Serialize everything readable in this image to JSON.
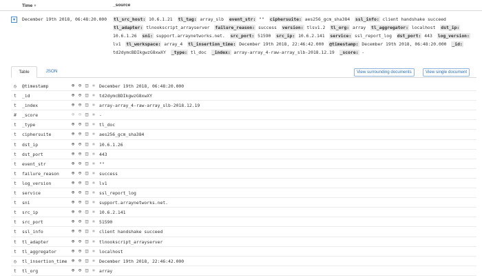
{
  "header": {
    "time_label": "Time",
    "time_sort_icon": "▾",
    "source_label": "_source"
  },
  "row": {
    "time": "December 19th 2018, 06:48:20.000",
    "toggle_icon": "▾",
    "source_pairs": [
      {
        "k": "tl_src_host:",
        "v": "10.6.1.21"
      },
      {
        "k": "tl_tag:",
        "v": "array_slb"
      },
      {
        "k": "event_str:",
        "v": "\"\""
      },
      {
        "k": "ciphersuite:",
        "v": "aes256_gcm_sha384"
      },
      {
        "k": "ssl_info:",
        "v": "client handshake succeed"
      },
      {
        "k": "tl_adapter:",
        "v": "tlnookscript_arrayserver"
      },
      {
        "k": "failure_reason:",
        "v": "success"
      },
      {
        "k": "version:",
        "v": "tlsv1.2"
      },
      {
        "k": "tl_org:",
        "v": "array"
      },
      {
        "k": "tl_aggregator:",
        "v": "localhost"
      },
      {
        "k": "dst_ip:",
        "v": "10.6.1.26"
      },
      {
        "k": "sni:",
        "v": "support.arraynetworks.net."
      },
      {
        "k": "src_port:",
        "v": "51590"
      },
      {
        "k": "src_ip:",
        "v": "10.6.2.141"
      },
      {
        "k": "service:",
        "v": "ssl_report_log"
      },
      {
        "k": "dst_port:",
        "v": "443"
      },
      {
        "k": "log_version:",
        "v": "lv1"
      },
      {
        "k": "tl_workspace:",
        "v": "array_4"
      },
      {
        "k": "tl_insertion_time:",
        "v": "December 19th 2018, 22:46:42.000"
      },
      {
        "k": "@timestamp:",
        "v": "December 19th 2018, 06:48:20.000"
      },
      {
        "k": "_id:",
        "v": "td2dymcBDIkgwzG8xwXY"
      },
      {
        "k": "_type:",
        "v": "tl_doc"
      },
      {
        "k": "_index:",
        "v": "array-array_4-raw-array_slb-2018.12.19"
      },
      {
        "k": "_score:",
        "v": "-"
      }
    ]
  },
  "tabs": {
    "table": "Table",
    "json": "JSON"
  },
  "buttons": {
    "surrounding": "View surrounding documents",
    "single": "View single document"
  },
  "action_icons": {
    "filter_for": "⊕",
    "filter_out": "⊖",
    "toggle_column": "◫",
    "exists": "✱"
  },
  "fields": [
    {
      "type": "◷",
      "name": "@timestamp",
      "value": "December 19th 2018, 06:48:20.000",
      "dim": false
    },
    {
      "type": "t",
      "name": "_id",
      "value": "td2dymcBDIkgwzG8xwXY",
      "dim": false
    },
    {
      "type": "t",
      "name": "_index",
      "value": "array-array_4-raw-array_slb-2018.12.19",
      "dim": false
    },
    {
      "type": "#",
      "name": "_score",
      "value": "-",
      "dim": true
    },
    {
      "type": "t",
      "name": "_type",
      "value": "tl_doc",
      "dim": false
    },
    {
      "type": "t",
      "name": "ciphersuite",
      "value": "aes256_gcm_sha384",
      "dim": false
    },
    {
      "type": "t",
      "name": "dst_ip",
      "value": "10.6.1.26",
      "dim": false
    },
    {
      "type": "t",
      "name": "dst_port",
      "value": "443",
      "dim": false
    },
    {
      "type": "t",
      "name": "event_str",
      "value": "\"\"",
      "dim": false
    },
    {
      "type": "t",
      "name": "failure_reason",
      "value": "success",
      "dim": false
    },
    {
      "type": "t",
      "name": "log_version",
      "value": "lv1",
      "dim": false
    },
    {
      "type": "t",
      "name": "service",
      "value": "ssl_report_log",
      "dim": false
    },
    {
      "type": "t",
      "name": "sni",
      "value": "support.arraynetworks.net.",
      "dim": false
    },
    {
      "type": "t",
      "name": "src_ip",
      "value": "10.6.2.141",
      "dim": false
    },
    {
      "type": "t",
      "name": "src_port",
      "value": "51590",
      "dim": false
    },
    {
      "type": "t",
      "name": "ssl_info",
      "value": "client handshake succeed",
      "dim": false
    },
    {
      "type": "t",
      "name": "tl_adapter",
      "value": "tlnookscript_arrayserver",
      "dim": false
    },
    {
      "type": "t",
      "name": "tl_aggregator",
      "value": "localhost",
      "dim": false
    },
    {
      "type": "◷",
      "name": "tl_insertion_time",
      "value": "December 19th 2018, 22:46:42.000",
      "dim": false
    },
    {
      "type": "t",
      "name": "tl_org",
      "value": "array",
      "dim": false
    }
  ]
}
